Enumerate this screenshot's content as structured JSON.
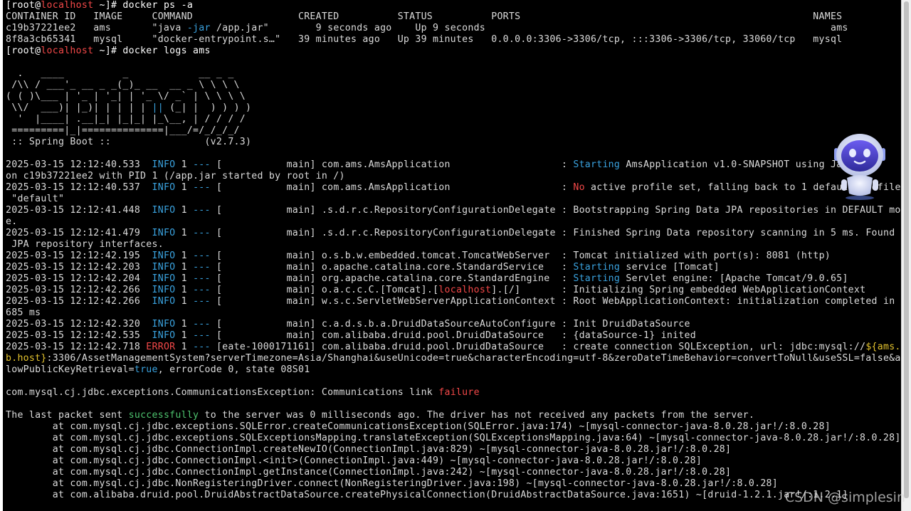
{
  "lines": [
    {
      "t": 0,
      "segs": [
        {
          "c": "w",
          "s": "[root@"
        },
        {
          "c": "r",
          "s": "localhost"
        },
        {
          "c": "w",
          "s": " ~]# docker ps -a"
        }
      ]
    },
    {
      "t": 16,
      "segs": [
        {
          "c": "",
          "s": "CONTAINER ID   IMAGE     COMMAND                  CREATED          STATUS          PORTS                                                  NAMES"
        }
      ]
    },
    {
      "t": 32,
      "segs": [
        {
          "c": "",
          "s": "c19b37221ee2   ams       \"java "
        },
        {
          "c": "b",
          "s": "-jar"
        },
        {
          "c": "",
          "s": " /app.jar\"        9 seconds ago    Up 9 seconds                                                           ams"
        }
      ]
    },
    {
      "t": 48,
      "segs": [
        {
          "c": "",
          "s": "8f8a3cb65341   mysql     \"docker-entrypoint.s…\"   39 minutes ago   Up 39 minutes   0.0.0.0:3306->3306/tcp, :::3306->3306/tcp, 33060/tcp   mysql"
        }
      ]
    },
    {
      "t": 64,
      "segs": [
        {
          "c": "w",
          "s": "[root@"
        },
        {
          "c": "r",
          "s": "localhost"
        },
        {
          "c": "w",
          "s": " ~]# docker logs ams"
        }
      ]
    },
    {
      "t": 96,
      "segs": [
        {
          "c": "",
          "s": "  .   ____          _            __ _ _"
        }
      ]
    },
    {
      "t": 112,
      "segs": [
        {
          "c": "",
          "s": " /\\\\ / ___'_ __ _ _(_)_ __  __ _ \\ \\ \\ \\"
        }
      ]
    },
    {
      "t": 128,
      "segs": [
        {
          "c": "",
          "s": "( ( )\\___ | '_ | '_| | '_ \\/ _` | \\ \\ \\ \\"
        }
      ]
    },
    {
      "t": 144,
      "segs": [
        {
          "c": "",
          "s": " \\\\/  ___)| |_)| | | | | "
        },
        {
          "c": "b",
          "s": "||"
        },
        {
          "c": "",
          "s": " (_| |  ) ) ) )"
        }
      ]
    },
    {
      "t": 160,
      "segs": [
        {
          "c": "",
          "s": "  '  |____| .__|_| |_|_| |_\\__, | / / / /"
        }
      ]
    },
    {
      "t": 176,
      "segs": [
        {
          "c": "",
          "s": " =========|_|==============|___/=/_/_/_/"
        }
      ]
    },
    {
      "t": 192,
      "segs": [
        {
          "c": "",
          "s": " :: Spring Boot ::                (v2.7.3)"
        }
      ]
    },
    {
      "t": 224,
      "segs": [
        {
          "c": "",
          "s": "2025-03-15 12:12:40.533  "
        },
        {
          "c": "b",
          "s": "INFO"
        },
        {
          "c": "",
          "s": " 1 "
        },
        {
          "c": "b",
          "s": "---"
        },
        {
          "c": "",
          "s": " [           main] com.ams.AmsApplication                   : "
        },
        {
          "c": "b",
          "s": "Starting"
        },
        {
          "c": "",
          "s": " AmsApplication v1.0-SNAPSHOT using Java"
        }
      ]
    },
    {
      "t": 240,
      "segs": [
        {
          "c": "",
          "s": "on c19b37221ee2 with PID 1 (/app.jar started by root in /)"
        }
      ]
    },
    {
      "t": 256,
      "segs": [
        {
          "c": "",
          "s": "2025-03-15 12:12:40.537  "
        },
        {
          "c": "b",
          "s": "INFO"
        },
        {
          "c": "",
          "s": " 1 "
        },
        {
          "c": "b",
          "s": "---"
        },
        {
          "c": "",
          "s": " [           main] com.ams.AmsApplication                   : "
        },
        {
          "c": "r",
          "s": "No"
        },
        {
          "c": "",
          "s": " active profile set, falling back to 1 default profile:"
        }
      ]
    },
    {
      "t": 272,
      "segs": [
        {
          "c": "",
          "s": " \"default\""
        }
      ]
    },
    {
      "t": 288,
      "segs": [
        {
          "c": "",
          "s": "2025-03-15 12:12:41.448  "
        },
        {
          "c": "b",
          "s": "INFO"
        },
        {
          "c": "",
          "s": " 1 "
        },
        {
          "c": "b",
          "s": "---"
        },
        {
          "c": "",
          "s": " [           main] .s.d.r.c.RepositoryConfigurationDelegate : Bootstrapping Spring Data JPA repositories in DEFAULT mod"
        }
      ]
    },
    {
      "t": 304,
      "segs": [
        {
          "c": "",
          "s": "e."
        }
      ]
    },
    {
      "t": 320,
      "segs": [
        {
          "c": "",
          "s": "2025-03-15 12:12:41.479  "
        },
        {
          "c": "b",
          "s": "INFO"
        },
        {
          "c": "",
          "s": " 1 "
        },
        {
          "c": "b",
          "s": "---"
        },
        {
          "c": "",
          "s": " [           main] .s.d.r.c.RepositoryConfigurationDelegate : Finished Spring Data repository scanning in 5 ms. Found 0"
        }
      ]
    },
    {
      "t": 336,
      "segs": [
        {
          "c": "",
          "s": " JPA repository interfaces."
        }
      ]
    },
    {
      "t": 352,
      "segs": [
        {
          "c": "",
          "s": "2025-03-15 12:12:42.195  "
        },
        {
          "c": "b",
          "s": "INFO"
        },
        {
          "c": "",
          "s": " 1 "
        },
        {
          "c": "b",
          "s": "---"
        },
        {
          "c": "",
          "s": " [           main] o.s.b.w.embedded.tomcat.TomcatWebServer  : Tomcat initialized with port(s): 8081 (http)"
        }
      ]
    },
    {
      "t": 368,
      "segs": [
        {
          "c": "",
          "s": "2025-03-15 12:12:42.203  "
        },
        {
          "c": "b",
          "s": "INFO"
        },
        {
          "c": "",
          "s": " 1 "
        },
        {
          "c": "b",
          "s": "---"
        },
        {
          "c": "",
          "s": " [           main] o.apache.catalina.core.StandardService   : "
        },
        {
          "c": "b",
          "s": "Starting"
        },
        {
          "c": "",
          "s": " service [Tomcat]"
        }
      ]
    },
    {
      "t": 384,
      "segs": [
        {
          "c": "",
          "s": "2025-03-15 12:12:42.204  "
        },
        {
          "c": "b",
          "s": "INFO"
        },
        {
          "c": "",
          "s": " 1 "
        },
        {
          "c": "b",
          "s": "---"
        },
        {
          "c": "",
          "s": " [           main] org.apache.catalina.core.StandardEngine  : "
        },
        {
          "c": "b",
          "s": "Starting"
        },
        {
          "c": "",
          "s": " Servlet engine: [Apache Tomcat/9.0.65]"
        }
      ]
    },
    {
      "t": 400,
      "segs": [
        {
          "c": "",
          "s": "2025-03-15 12:12:42.266  "
        },
        {
          "c": "b",
          "s": "INFO"
        },
        {
          "c": "",
          "s": " 1 "
        },
        {
          "c": "b",
          "s": "---"
        },
        {
          "c": "",
          "s": " [           main] o.a.c.c.C.[Tomcat].["
        },
        {
          "c": "r",
          "s": "localhost"
        },
        {
          "c": "",
          "s": "].[/]       : Initializing Spring embedded WebApplicationContext"
        }
      ]
    },
    {
      "t": 416,
      "segs": [
        {
          "c": "",
          "s": "2025-03-15 12:12:42.266  "
        },
        {
          "c": "b",
          "s": "INFO"
        },
        {
          "c": "",
          "s": " 1 "
        },
        {
          "c": "b",
          "s": "---"
        },
        {
          "c": "",
          "s": " [           main] w.s.c.ServletWebServerApplicationContext : Root WebApplicationContext: initialization completed in 1"
        }
      ]
    },
    {
      "t": 432,
      "segs": [
        {
          "c": "",
          "s": "685 ms"
        }
      ]
    },
    {
      "t": 448,
      "segs": [
        {
          "c": "",
          "s": "2025-03-15 12:12:42.320  "
        },
        {
          "c": "b",
          "s": "INFO"
        },
        {
          "c": "",
          "s": " 1 "
        },
        {
          "c": "b",
          "s": "---"
        },
        {
          "c": "",
          "s": " [           main] c.a.d.s.b.a.DruidDataSourceAutoConfigure : Init DruidDataSource"
        }
      ]
    },
    {
      "t": 464,
      "segs": [
        {
          "c": "",
          "s": "2025-03-15 12:12:42.535  "
        },
        {
          "c": "b",
          "s": "INFO"
        },
        {
          "c": "",
          "s": " 1 "
        },
        {
          "c": "b",
          "s": "---"
        },
        {
          "c": "",
          "s": " [           main] com.alibaba.druid.pool.DruidDataSource   : {dataSource-1} inited"
        }
      ]
    },
    {
      "t": 480,
      "segs": [
        {
          "c": "",
          "s": "2025-03-15 12:12:42.718 "
        },
        {
          "c": "r",
          "s": "ERROR"
        },
        {
          "c": "",
          "s": " 1 "
        },
        {
          "c": "b",
          "s": "---"
        },
        {
          "c": "",
          "s": " [eate-1000171161] com.alibaba.druid.pool.DruidDataSource   : create connection SQLException, url: jdbc:mysql://"
        },
        {
          "c": "y",
          "s": "${ams.d"
        }
      ]
    },
    {
      "t": 496,
      "segs": [
        {
          "c": "y",
          "s": "b.host}"
        },
        {
          "c": "",
          "s": ":3306/AssetManagementSystem?serverTimezone=Asia/Shanghai&useUnicode=true&characterEncoding=utf-8&zeroDateTimeBehavior=convertToNull&useSSL=false&al"
        }
      ]
    },
    {
      "t": 512,
      "segs": [
        {
          "c": "",
          "s": "lowPublicKeyRetrieval="
        },
        {
          "c": "b",
          "s": "true"
        },
        {
          "c": "",
          "s": ", errorCode 0, state 08S01"
        }
      ]
    },
    {
      "t": 544,
      "segs": [
        {
          "c": "",
          "s": "com.mysql.cj.jdbc.exceptions.CommunicationsException: Communications link "
        },
        {
          "c": "r",
          "s": "failure"
        }
      ]
    },
    {
      "t": 576,
      "segs": [
        {
          "c": "",
          "s": "The last packet sent "
        },
        {
          "c": "g",
          "s": "successfully"
        },
        {
          "c": "",
          "s": " to the server was 0 milliseconds ago. The driver has not received any packets from the server."
        }
      ]
    },
    {
      "t": 592,
      "segs": [
        {
          "c": "",
          "s": "        at com.mysql.cj.jdbc.exceptions.SQLError.createCommunicationsException(SQLError.java:174) ~[mysql-connector-java-8.0.28.jar!/:8.0.28]"
        }
      ]
    },
    {
      "t": 608,
      "segs": [
        {
          "c": "",
          "s": "        at com.mysql.cj.jdbc.exceptions.SQLExceptionsMapping.translateException(SQLExceptionsMapping.java:64) ~[mysql-connector-java-8.0.28.jar!/:8.0.28]"
        }
      ]
    },
    {
      "t": 624,
      "segs": [
        {
          "c": "",
          "s": "        at com.mysql.cj.jdbc.ConnectionImpl.createNewIO(ConnectionImpl.java:829) ~[mysql-connector-java-8.0.28.jar!/:8.0.28]"
        }
      ]
    },
    {
      "t": 640,
      "segs": [
        {
          "c": "",
          "s": "        at com.mysql.cj.jdbc.ConnectionImpl.<init>(ConnectionImpl.java:449) ~[mysql-connector-java-8.0.28.jar!/:8.0.28]"
        }
      ]
    },
    {
      "t": 656,
      "segs": [
        {
          "c": "",
          "s": "        at com.mysql.cj.jdbc.ConnectionImpl.getInstance(ConnectionImpl.java:242) ~[mysql-connector-java-8.0.28.jar!/:8.0.28]"
        }
      ]
    },
    {
      "t": 672,
      "segs": [
        {
          "c": "",
          "s": "        at com.mysql.cj.jdbc.NonRegisteringDriver.connect(NonRegisteringDriver.java:198) ~[mysql-connector-java-8.0.28.jar!/:8.0.28]"
        }
      ]
    },
    {
      "t": 688,
      "segs": [
        {
          "c": "",
          "s": "        at com.alibaba.druid.pool.DruidAbstractDataSource.createPhysicalConnection(DruidAbstractDataSource.java:1651) ~[druid-1.2.1.jar!/:1.2.1]"
        }
      ]
    }
  ],
  "overlay": {
    "watermark": "CSDN @simplesin",
    "assistant_icon": "robot-assistant-icon"
  },
  "colors": {
    "background": "#000000",
    "text": "#dcdcdc",
    "prompt": "#ffffff",
    "red": "#f34848",
    "blue": "#3aa3e0",
    "green": "#4ec46f",
    "yellow": "#e5c42e"
  }
}
